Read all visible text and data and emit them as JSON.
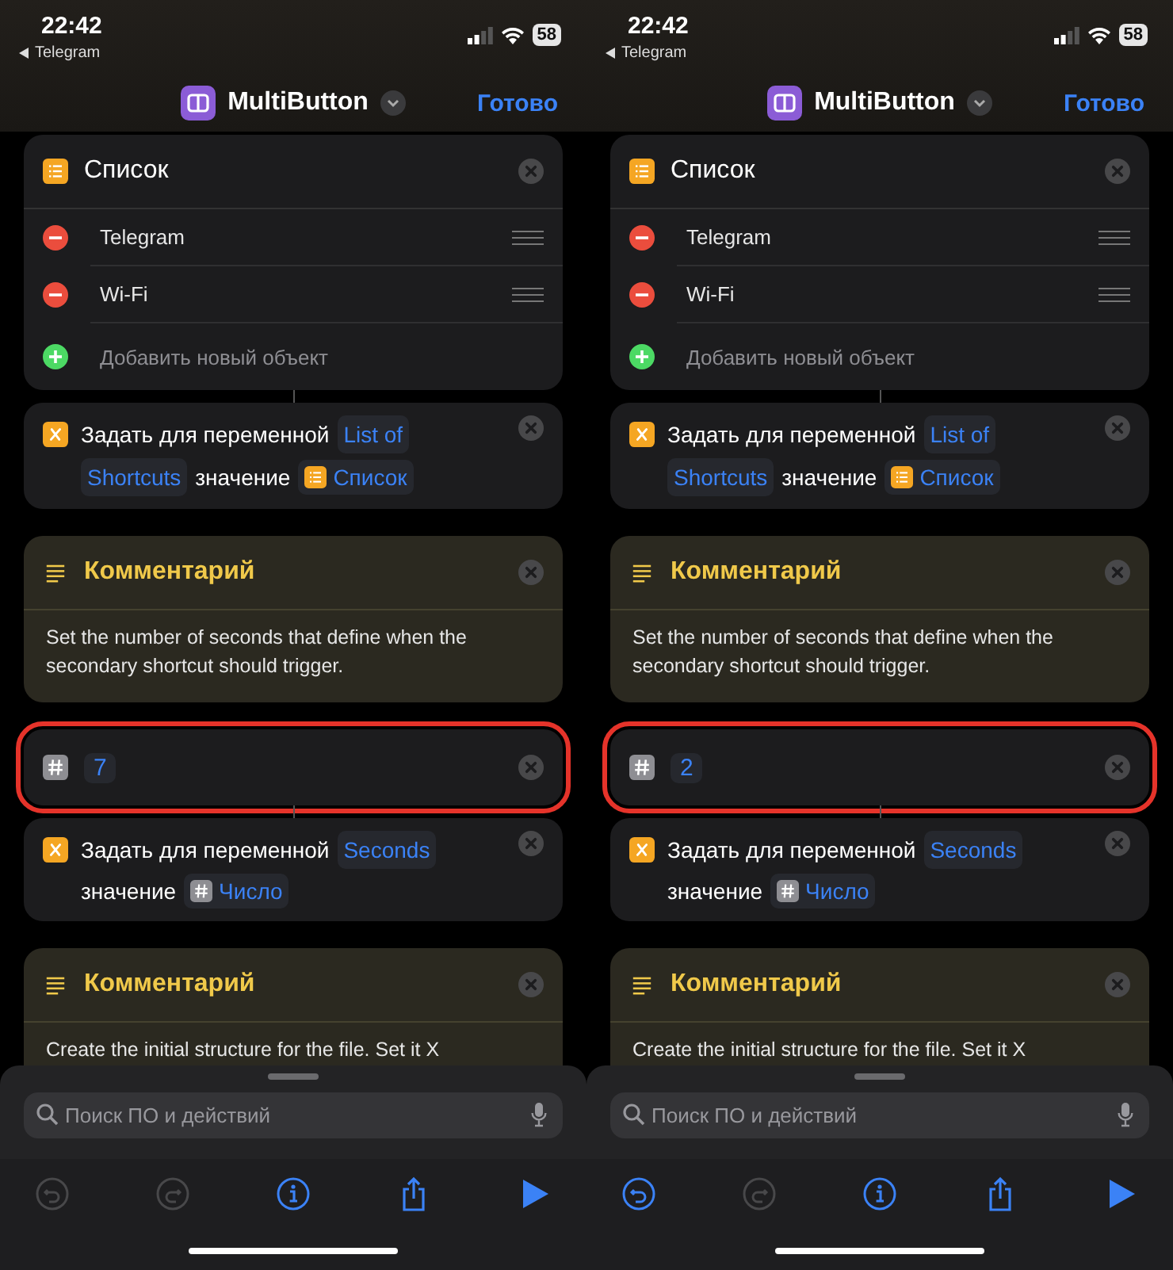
{
  "phones": [
    {
      "status": {
        "time": "22:42",
        "back": "Telegram",
        "battery": "58"
      },
      "nav": {
        "title": "MultiButton",
        "done": "Готово"
      },
      "cards": [
        {
          "kind": "list",
          "title": "Список",
          "items": [
            {
              "text": "Telegram"
            },
            {
              "text": "Wi-Fi"
            }
          ],
          "add_label": "Добавить новый объект"
        },
        {
          "kind": "set_variable",
          "parts": [
            {
              "kind": "text",
              "text": "Задать для переменной"
            },
            {
              "kind": "variable",
              "text": "List of"
            },
            {
              "kind": "variable",
              "text": "Shortcuts"
            },
            {
              "kind": "text",
              "text": "значение"
            },
            {
              "kind": "list_output",
              "text": "Список"
            }
          ]
        },
        {
          "kind": "comment",
          "title": "Комментарий",
          "text": "Set the number of seconds that define when the secondary shortcut should trigger."
        },
        {
          "kind": "number",
          "value": "7",
          "highlighted": true
        },
        {
          "kind": "set_variable",
          "parts": [
            {
              "kind": "text",
              "text": "Задать для переменной"
            },
            {
              "kind": "variable",
              "text": "Seconds"
            },
            {
              "kind": "text",
              "text": "значение"
            },
            {
              "kind": "number_output",
              "text": "Число"
            }
          ]
        },
        {
          "kind": "comment",
          "title": "Комментарий",
          "text": "Create the initial structure for the file. Set it X"
        }
      ],
      "search": {
        "placeholder": "Поиск ПО и действий"
      },
      "toolbar": [
        {
          "kind": "undo",
          "disabled": true
        },
        {
          "kind": "redo",
          "disabled": true
        },
        {
          "kind": "info",
          "disabled": false
        },
        {
          "kind": "share",
          "disabled": false
        },
        {
          "kind": "run",
          "disabled": false
        }
      ]
    },
    {
      "status": {
        "time": "22:42",
        "back": "Telegram",
        "battery": "58"
      },
      "nav": {
        "title": "MultiButton",
        "done": "Готово"
      },
      "cards": [
        {
          "kind": "list",
          "title": "Список",
          "items": [
            {
              "text": "Telegram"
            },
            {
              "text": "Wi-Fi"
            }
          ],
          "add_label": "Добавить новый объект"
        },
        {
          "kind": "set_variable",
          "parts": [
            {
              "kind": "text",
              "text": "Задать для переменной"
            },
            {
              "kind": "variable",
              "text": "List of"
            },
            {
              "kind": "variable",
              "text": "Shortcuts"
            },
            {
              "kind": "text",
              "text": "значение"
            },
            {
              "kind": "list_output",
              "text": "Список"
            }
          ]
        },
        {
          "kind": "comment",
          "title": "Комментарий",
          "text": "Set the number of seconds that define when the secondary shortcut should trigger."
        },
        {
          "kind": "number",
          "value": "2",
          "highlighted": true
        },
        {
          "kind": "set_variable",
          "parts": [
            {
              "kind": "text",
              "text": "Задать для переменной"
            },
            {
              "kind": "variable",
              "text": "Seconds"
            },
            {
              "kind": "text",
              "text": "значение"
            },
            {
              "kind": "number_output",
              "text": "Число"
            }
          ]
        },
        {
          "kind": "comment",
          "title": "Комментарий",
          "text": "Create the initial structure for the file. Set it X"
        }
      ],
      "search": {
        "placeholder": "Поиск ПО и действий"
      },
      "toolbar": [
        {
          "kind": "undo",
          "disabled": false
        },
        {
          "kind": "redo",
          "disabled": true
        },
        {
          "kind": "info",
          "disabled": false
        },
        {
          "kind": "share",
          "disabled": false
        },
        {
          "kind": "run",
          "disabled": false
        }
      ]
    }
  ]
}
